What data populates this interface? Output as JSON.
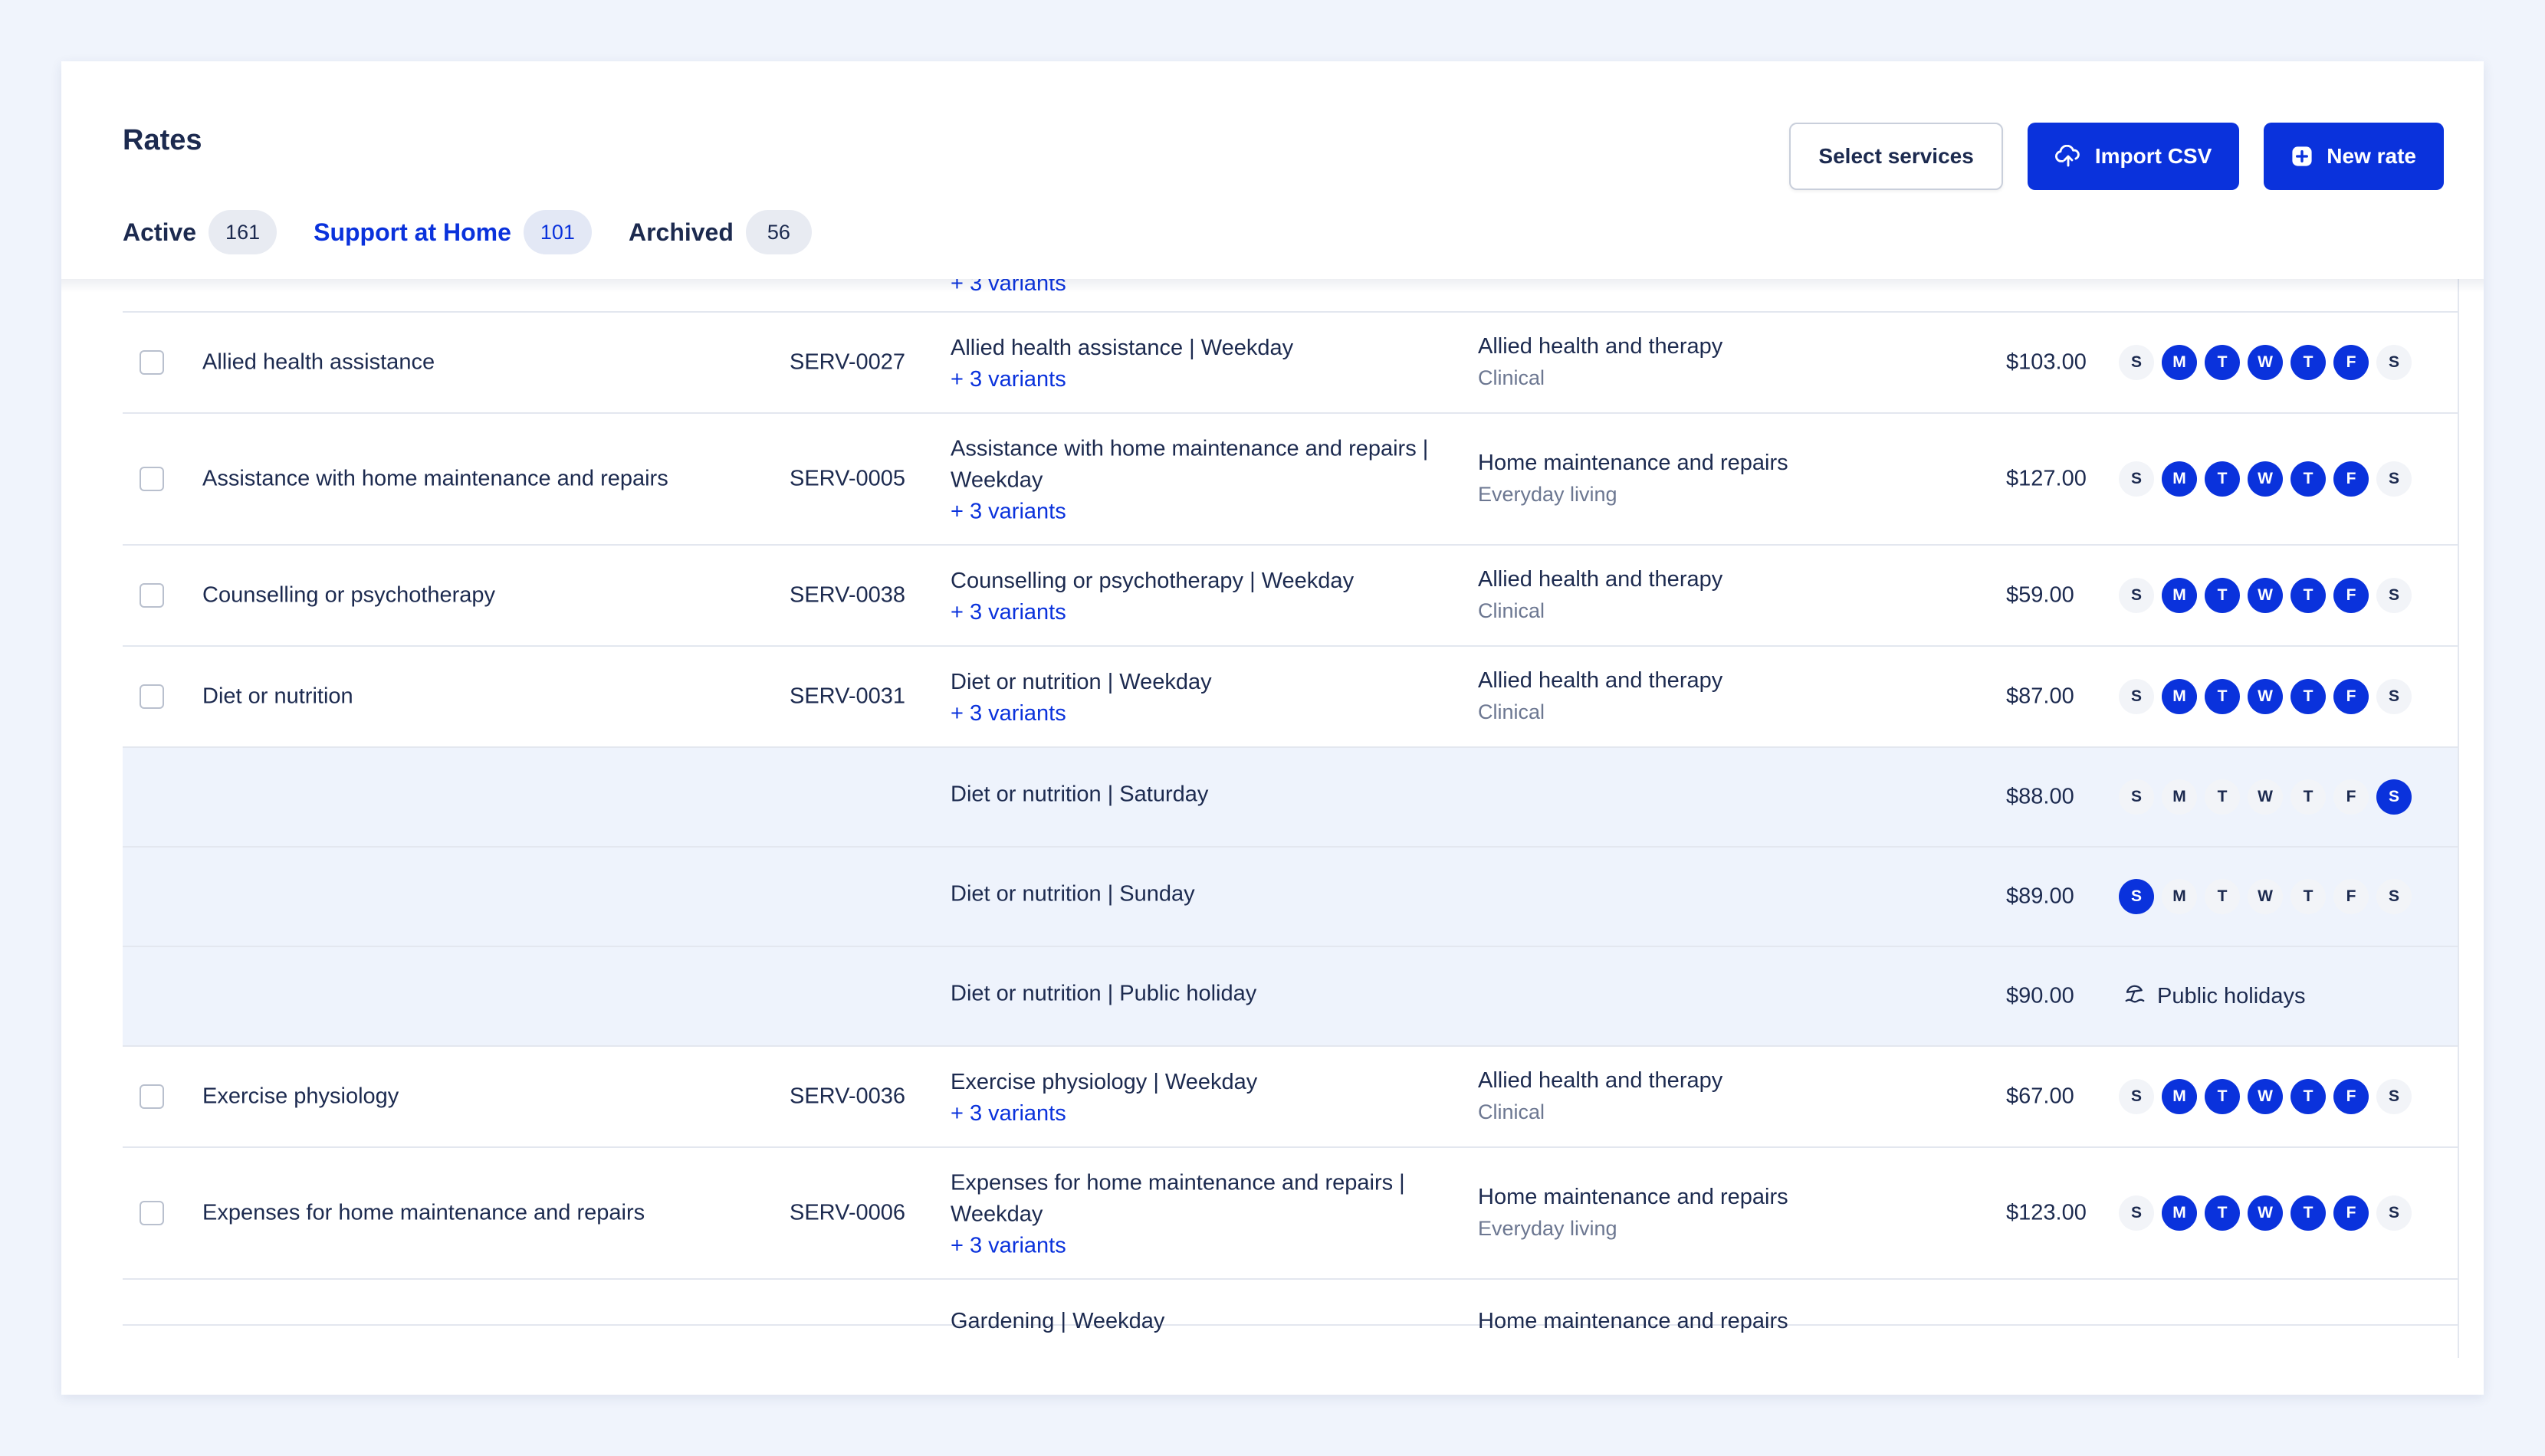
{
  "page": {
    "title": "Rates"
  },
  "actions": {
    "select_services": "Select services",
    "import_csv": "Import CSV",
    "new_rate": "New rate"
  },
  "tabs": [
    {
      "label": "Active",
      "count": "161",
      "active": false
    },
    {
      "label": "Support at Home",
      "count": "101",
      "active": true
    },
    {
      "label": "Archived",
      "count": "56",
      "active": false
    }
  ],
  "colors": {
    "accent": "#0a32dc",
    "variant_row_bg": "#eef3fc"
  },
  "weekday_letters": [
    "S",
    "M",
    "T",
    "W",
    "T",
    "F",
    "S"
  ],
  "rows": [
    {
      "type": "partial-top",
      "variants": "+ 3 variants"
    },
    {
      "type": "service",
      "name": "Allied health assistance",
      "code": "SERV-0027",
      "rate_name": "Allied health assistance | Weekday",
      "variants": "+ 3 variants",
      "category": "Allied health and therapy",
      "subcategory": "Clinical",
      "price": "$103.00",
      "days": [
        false,
        true,
        true,
        true,
        true,
        true,
        false
      ]
    },
    {
      "type": "service",
      "name": "Assistance with home maintenance and repairs",
      "code": "SERV-0005",
      "rate_name": "Assistance with home maintenance and repairs | Weekday",
      "variants": "+ 3 variants",
      "category": "Home maintenance and repairs",
      "subcategory": "Everyday living",
      "price": "$127.00",
      "days": [
        false,
        true,
        true,
        true,
        true,
        true,
        false
      ]
    },
    {
      "type": "service",
      "name": "Counselling or psychotherapy",
      "code": "SERV-0038",
      "rate_name": "Counselling or psychotherapy | Weekday",
      "variants": "+ 3 variants",
      "category": "Allied health and therapy",
      "subcategory": "Clinical",
      "price": "$59.00",
      "days": [
        false,
        true,
        true,
        true,
        true,
        true,
        false
      ]
    },
    {
      "type": "service",
      "name": "Diet or nutrition",
      "code": "SERV-0031",
      "rate_name": "Diet or nutrition | Weekday",
      "variants": "+ 3 variants",
      "category": "Allied health and therapy",
      "subcategory": "Clinical",
      "price": "$87.00",
      "days": [
        false,
        true,
        true,
        true,
        true,
        true,
        false
      ]
    },
    {
      "type": "variant",
      "rate_name": "Diet or nutrition | Saturday",
      "price": "$88.00",
      "days": [
        false,
        false,
        false,
        false,
        false,
        false,
        true
      ]
    },
    {
      "type": "variant",
      "rate_name": "Diet or nutrition | Sunday",
      "price": "$89.00",
      "days": [
        true,
        false,
        false,
        false,
        false,
        false,
        false
      ]
    },
    {
      "type": "variant-holiday",
      "rate_name": "Diet or nutrition | Public holiday",
      "price": "$90.00",
      "holiday_label": "Public holidays",
      "holiday_icon": "beach-umbrella-icon"
    },
    {
      "type": "service",
      "name": "Exercise physiology",
      "code": "SERV-0036",
      "rate_name": "Exercise physiology | Weekday",
      "variants": "+ 3 variants",
      "category": "Allied health and therapy",
      "subcategory": "Clinical",
      "price": "$67.00",
      "days": [
        false,
        true,
        true,
        true,
        true,
        true,
        false
      ]
    },
    {
      "type": "service",
      "name": "Expenses for home maintenance and repairs",
      "code": "SERV-0006",
      "rate_name": "Expenses for home maintenance and repairs | Weekday",
      "variants": "+ 3 variants",
      "category": "Home maintenance and repairs",
      "subcategory": "Everyday living",
      "price": "$123.00",
      "days": [
        false,
        true,
        true,
        true,
        true,
        true,
        false
      ]
    },
    {
      "type": "partial-bottom",
      "rate_name": "Gardening | Weekday",
      "category": "Home maintenance and repairs"
    }
  ]
}
